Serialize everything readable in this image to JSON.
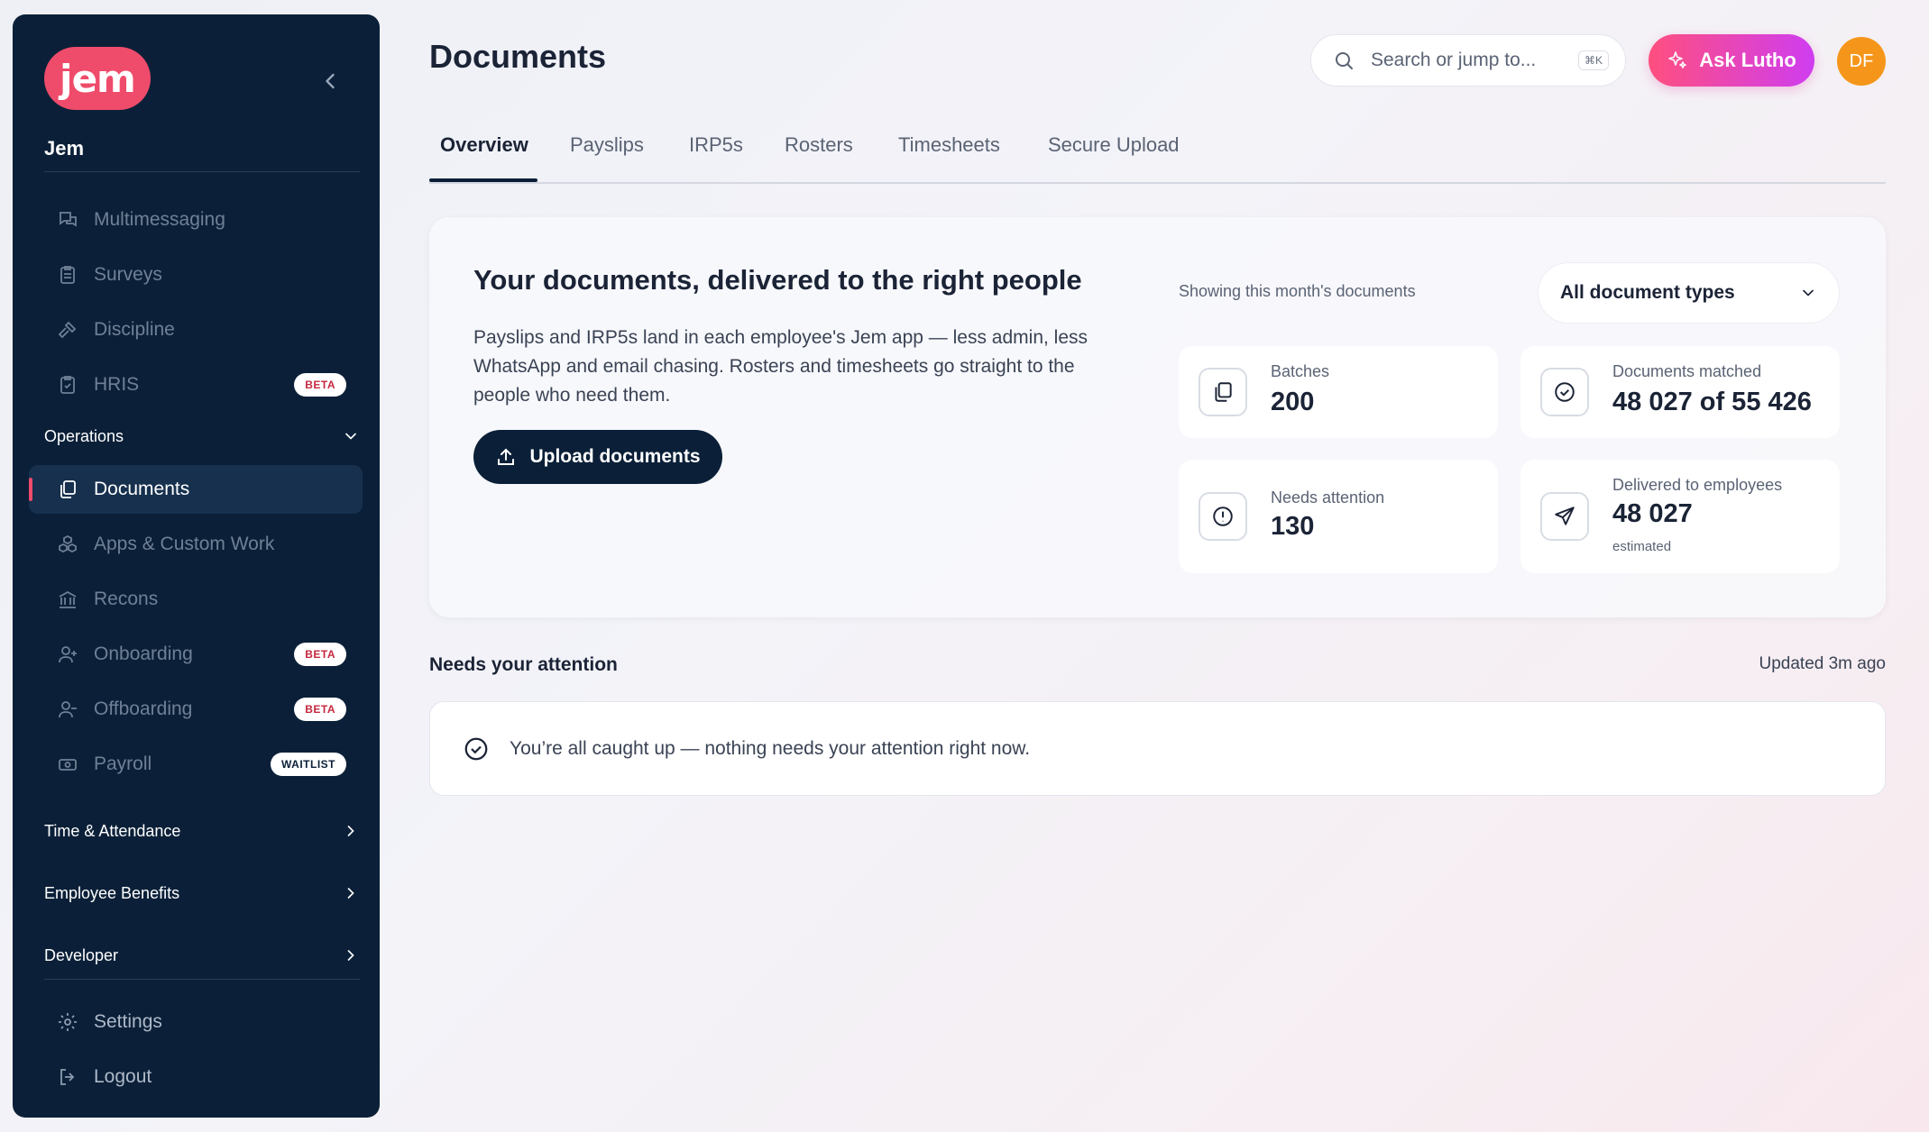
{
  "sidebar": {
    "logo_text": "jem",
    "org_name": "Jem",
    "items": [
      {
        "label": "Multimessaging",
        "icon": "chat-bubbles-icon"
      },
      {
        "label": "Surveys",
        "icon": "clipboard-icon"
      },
      {
        "label": "Discipline",
        "icon": "gavel-icon"
      },
      {
        "label": "HRIS",
        "icon": "clipboard-check-icon",
        "badge": "BETA"
      }
    ],
    "operations_label": "Operations",
    "ops_items": [
      {
        "label": "Documents",
        "icon": "documents-icon",
        "active": true
      },
      {
        "label": "Apps & Custom Work",
        "icon": "cubes-icon"
      },
      {
        "label": "Recons",
        "icon": "bank-icon"
      },
      {
        "label": "Onboarding",
        "icon": "user-plus-icon",
        "badge": "BETA"
      },
      {
        "label": "Offboarding",
        "icon": "user-minus-icon",
        "badge": "BETA"
      },
      {
        "label": "Payroll",
        "icon": "banknote-icon",
        "badge": "WAITLIST"
      }
    ],
    "sections": [
      "Time & Attendance",
      "Employee Benefits",
      "Developer"
    ],
    "settings_label": "Settings",
    "logout_label": "Logout"
  },
  "header": {
    "title": "Documents",
    "search_placeholder": "Search or jump to...",
    "search_shortcut": "⌘K",
    "ask_label": "Ask Lutho",
    "avatar_initials": "DF"
  },
  "tabs": [
    "Overview",
    "Payslips",
    "IRP5s",
    "Rosters",
    "Timesheets",
    "Secure Upload"
  ],
  "hero": {
    "title": "Your documents, delivered to the right people",
    "description": "Payslips and IRP5s land in each employee's Jem app — less admin, less WhatsApp and email chasing. Rosters and timesheets go straight to the people who need them.",
    "upload_label": "Upload documents",
    "showing_text": "Showing this month's documents",
    "filter_value": "All document types",
    "stats": {
      "batches_label": "Batches",
      "batches_value": "200",
      "matched_label": "Documents matched",
      "matched_value": "48 027 of 55 426",
      "attention_label": "Needs attention",
      "attention_value": "130",
      "delivered_label": "Delivered to employees",
      "delivered_value": "48 027",
      "delivered_sub": "estimated"
    }
  },
  "attention": {
    "title": "Needs your attention",
    "updated": "Updated 3m ago",
    "message": "You’re all caught up — nothing needs your attention right now."
  },
  "colors": {
    "sidebar_bg": "#0b2038",
    "brand_pink": "#ef4b6b",
    "avatar_orange": "#f5961b"
  }
}
